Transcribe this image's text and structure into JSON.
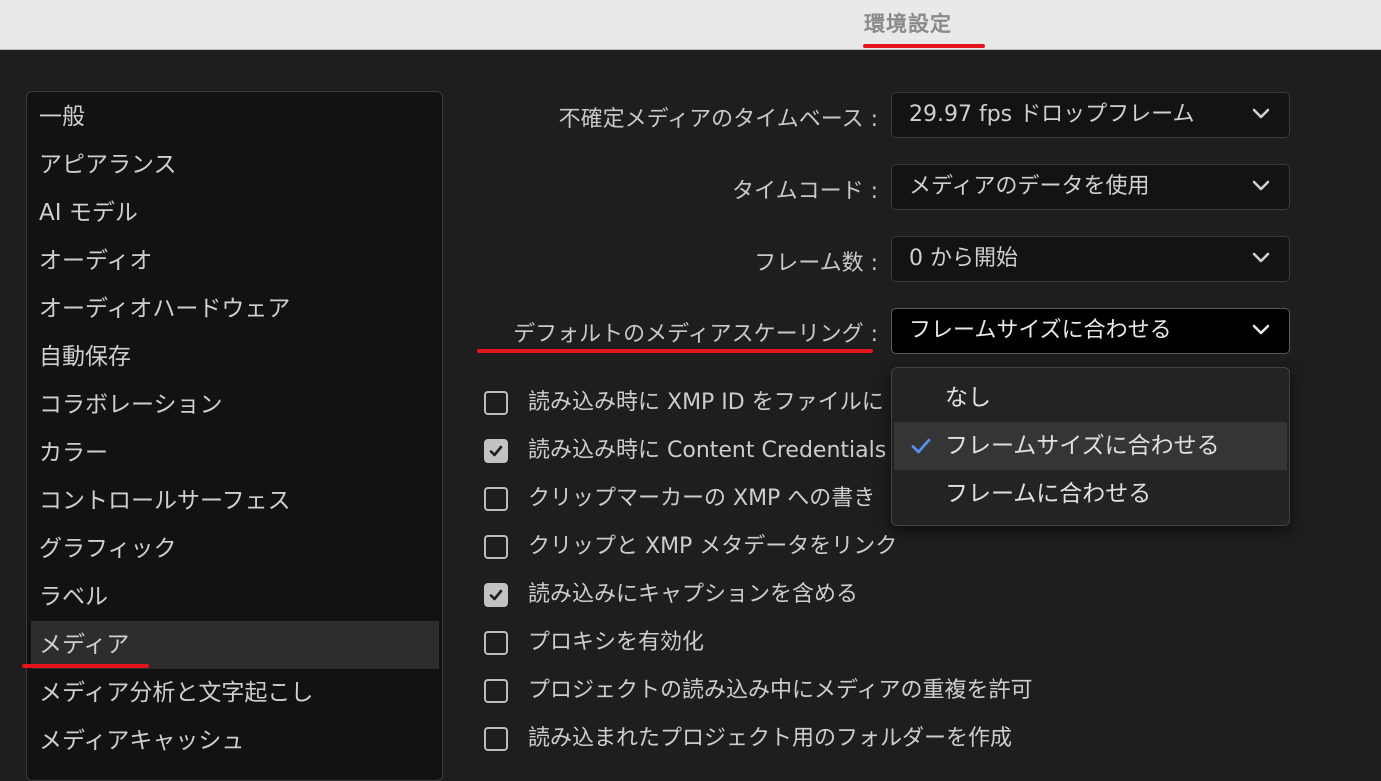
{
  "window": {
    "title": "環境設定"
  },
  "sidebar": {
    "items": [
      {
        "label": "一般"
      },
      {
        "label": "アピアランス"
      },
      {
        "label": "AI モデル"
      },
      {
        "label": "オーディオ"
      },
      {
        "label": "オーディオハードウェア"
      },
      {
        "label": "自動保存"
      },
      {
        "label": "コラボレーション"
      },
      {
        "label": "カラー"
      },
      {
        "label": "コントロールサーフェス"
      },
      {
        "label": "グラフィック"
      },
      {
        "label": "ラベル"
      },
      {
        "label": "メディア"
      },
      {
        "label": "メディア分析と文字起こし"
      },
      {
        "label": "メディアキャッシュ"
      }
    ],
    "selected": "メディア"
  },
  "settings": {
    "timebase": {
      "label": "不確定メディアのタイムベース :",
      "value": "29.97 fps ドロップフレーム"
    },
    "timecode": {
      "label": "タイムコード :",
      "value": "メディアのデータを使用"
    },
    "frame_count": {
      "label": "フレーム数 :",
      "value": "0 から開始"
    },
    "scaling": {
      "label": "デフォルトのメディアスケーリング :",
      "value": "フレームサイズに合わせる"
    }
  },
  "checkboxes": [
    {
      "label": "読み込み時に XMP ID をファイルに",
      "checked": false
    },
    {
      "label": "読み込み時に Content Credentials の",
      "checked": true
    },
    {
      "label": "クリップマーカーの XMP への書き",
      "checked": false
    },
    {
      "label": "クリップと XMP メタデータをリンク",
      "checked": false
    },
    {
      "label": "読み込みにキャプションを含める",
      "checked": true
    },
    {
      "label": "プロキシを有効化",
      "checked": false
    },
    {
      "label": "プロジェクトの読み込み中にメディアの重複を許可",
      "checked": false
    },
    {
      "label": "読み込まれたプロジェクト用のフォルダーを作成",
      "checked": false
    }
  ],
  "scaling_menu": {
    "options": [
      {
        "label": "なし",
        "selected": false
      },
      {
        "label": "フレームサイズに合わせる",
        "selected": true
      },
      {
        "label": "フレームに合わせる",
        "selected": false
      }
    ]
  },
  "colors": {
    "highlight_red": "#e5141b",
    "check_blue": "#5b8ff0",
    "background": "#1e1e1e"
  }
}
